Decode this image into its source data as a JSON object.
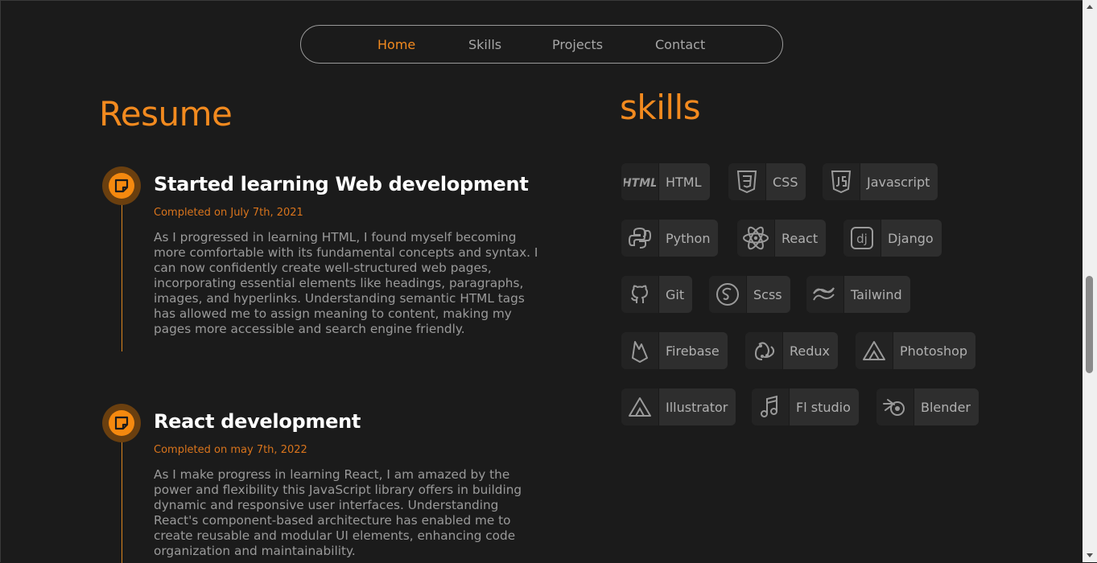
{
  "nav": {
    "items": [
      {
        "label": "Home"
      },
      {
        "label": "Skills"
      },
      {
        "label": "Projects"
      },
      {
        "label": "Contact"
      }
    ],
    "active": "Home"
  },
  "resume": {
    "title": "Resume",
    "entries": [
      {
        "title": "Started learning Web development",
        "date": "Completed on July 7th, 2021",
        "description": "As I progressed in learning HTML, I found myself becoming more comfortable with its fundamental concepts and syntax. I can now confidently create well-structured web pages, incorporating essential elements like headings, paragraphs, images, and hyperlinks. Understanding semantic HTML tags has allowed me to assign meaning to content, making my pages more accessible and search engine friendly.",
        "icon": "sticky-note-icon"
      },
      {
        "title": "React development",
        "date": "Completed on may 7th, 2022",
        "description": "As I make progress in learning React, I am amazed by the power and flexibility this JavaScript library offers in building dynamic and responsive user interfaces. Understanding React's component-based architecture has enabled me to create reusable and modular UI elements, enhancing code organization and maintainability.",
        "icon": "sticky-note-icon"
      }
    ]
  },
  "skills": {
    "title": "skills",
    "items": [
      {
        "label": "HTML",
        "icon": "html-icon"
      },
      {
        "label": "CSS",
        "icon": "css3-icon"
      },
      {
        "label": "Javascript",
        "icon": "javascript-icon"
      },
      {
        "label": "Python",
        "icon": "python-icon"
      },
      {
        "label": "React",
        "icon": "react-icon"
      },
      {
        "label": "Django",
        "icon": "django-icon"
      },
      {
        "label": "Git",
        "icon": "github-icon"
      },
      {
        "label": "Scss",
        "icon": "sass-icon"
      },
      {
        "label": "Tailwind",
        "icon": "tailwind-icon"
      },
      {
        "label": "Firebase",
        "icon": "firebase-icon"
      },
      {
        "label": "Redux",
        "icon": "redux-icon"
      },
      {
        "label": "Photoshop",
        "icon": "photoshop-icon"
      },
      {
        "label": "Illustrator",
        "icon": "illustrator-icon"
      },
      {
        "label": "Fl studio",
        "icon": "music-note-icon"
      },
      {
        "label": "Blender",
        "icon": "blender-icon"
      }
    ]
  },
  "colors": {
    "accent": "#f28a1f",
    "background": "#1b1b1b",
    "text_muted": "#9a9a9a"
  }
}
